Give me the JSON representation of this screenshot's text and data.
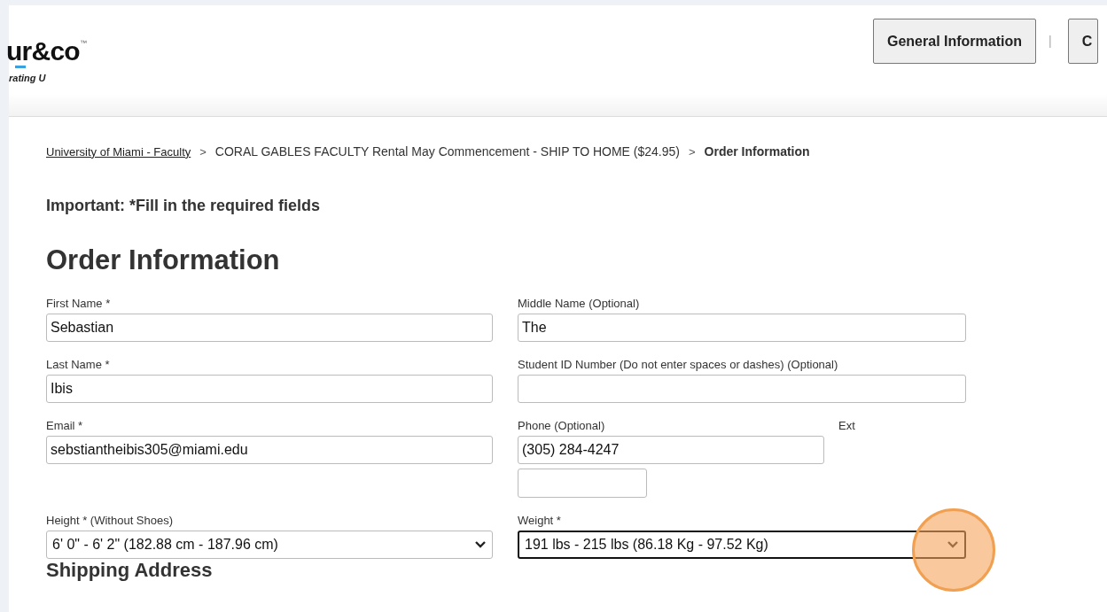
{
  "header": {
    "logo": {
      "text": "ur&co",
      "mark": "™",
      "tagline": "rating U"
    },
    "nav": [
      {
        "label": "General Information"
      },
      {
        "label": "C"
      }
    ],
    "separator": "|"
  },
  "breadcrumb": [
    {
      "label": "University of Miami - Faculty",
      "kind": "link"
    },
    {
      "label": ">",
      "kind": "sep"
    },
    {
      "label": "CORAL GABLES FACULTY Rental May Commencement - SHIP TO HOME ($24.95)",
      "kind": "text"
    },
    {
      "label": ">",
      "kind": "sep"
    },
    {
      "label": "Order Information",
      "kind": "current"
    }
  ],
  "notice": "Important: *Fill in the required fields",
  "heading": "Order Information",
  "rows": [
    {
      "left": {
        "label": "First Name *",
        "kind": "text",
        "value": "Sebastian"
      },
      "right": {
        "label": "Middle Name (Optional)",
        "kind": "text",
        "value": "The"
      }
    },
    {
      "left": {
        "label": "Last Name *",
        "kind": "text",
        "value": "Ibis"
      },
      "right": {
        "label": "Student ID Number (Do not enter spaces or dashes) (Optional)",
        "kind": "text"
      }
    },
    {
      "left": {
        "label": "Email *",
        "kind": "text",
        "value": "sebstiantheibis305@miami.edu"
      },
      "right": {
        "label": "Phone (Optional)",
        "kind": "phone",
        "value": "(305) 284-4247",
        "ext_label": "Ext"
      }
    },
    {
      "left": {
        "label": "Height * (Without Shoes)",
        "kind": "select",
        "value": "6' 0\" - 6' 2\" (182.88 cm - 187.96 cm)",
        "focused": false
      },
      "right": {
        "label": "Weight *",
        "kind": "select",
        "value": "191 lbs - 215 lbs (86.18 Kg - 97.52 Kg)",
        "focused": true,
        "highlighted": true
      }
    }
  ],
  "section": "Shipping Address"
}
